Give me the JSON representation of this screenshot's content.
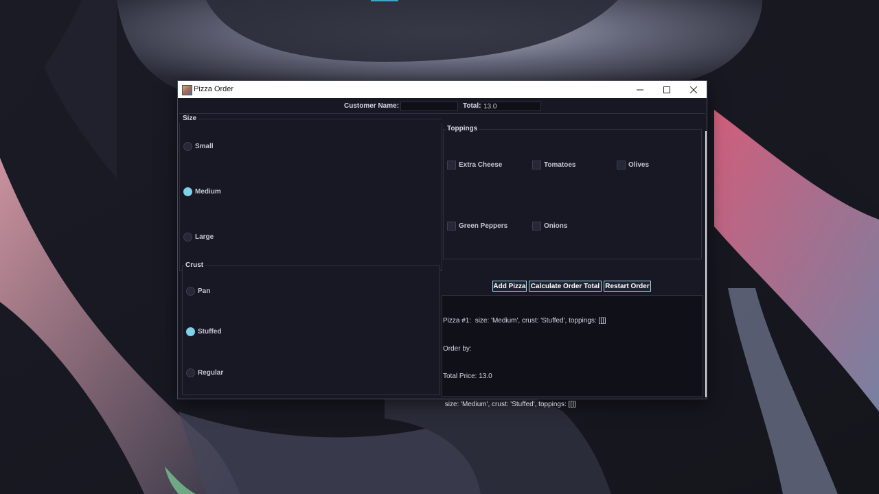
{
  "window": {
    "title": "Pizza Order"
  },
  "header": {
    "customer_label": "Customer Name:",
    "customer_value": "",
    "total_label": "Total:",
    "total_value": "13.0"
  },
  "size": {
    "title": "Size",
    "options": [
      {
        "label": "Small",
        "selected": false
      },
      {
        "label": "Medium",
        "selected": true
      },
      {
        "label": "Large",
        "selected": false
      }
    ]
  },
  "toppings": {
    "title": "Toppings",
    "options": [
      {
        "label": "Extra Cheese",
        "checked": false
      },
      {
        "label": "Tomatoes",
        "checked": false
      },
      {
        "label": "Olives",
        "checked": false
      },
      {
        "label": "Green Peppers",
        "checked": false
      },
      {
        "label": "Onions",
        "checked": false
      }
    ]
  },
  "crust": {
    "title": "Crust",
    "options": [
      {
        "label": "Pan",
        "selected": false
      },
      {
        "label": "Stuffed",
        "selected": true
      },
      {
        "label": "Regular",
        "selected": false
      }
    ]
  },
  "buttons": {
    "add_pizza": "Add Pizza",
    "calculate": "Calculate Order Total",
    "restart": "Restart Order"
  },
  "output": {
    "lines": [
      "Pizza #1:  size: 'Medium', crust: 'Stuffed', toppings: [[]]",
      "Order by: ",
      "Total Price: 13.0",
      " size: 'Medium', crust: 'Stuffed', toppings: [[]]"
    ]
  },
  "colors": {
    "accent": "#7ed1e8",
    "button_border": "#9fd8ea",
    "panel_bg": "#181824"
  }
}
